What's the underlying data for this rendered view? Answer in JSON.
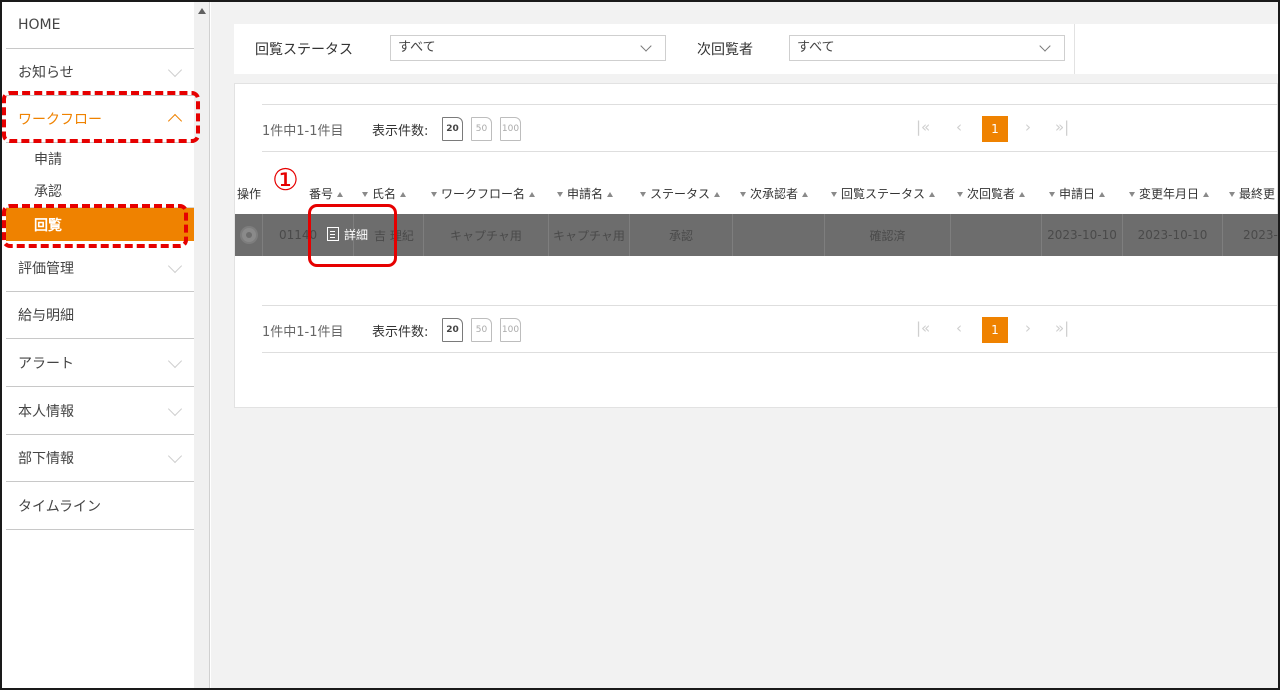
{
  "sidebar": {
    "items": [
      {
        "label": "HOME",
        "has_chevron": false
      },
      {
        "label": "お知らせ",
        "has_chevron": true
      },
      {
        "label": "ワークフロー",
        "active": true
      },
      {
        "label": "評価管理",
        "has_chevron": true
      },
      {
        "label": "給与明細",
        "has_chevron": false
      },
      {
        "label": "アラート",
        "has_chevron": true
      },
      {
        "label": "本人情報",
        "has_chevron": true
      },
      {
        "label": "部下情報",
        "has_chevron": true
      },
      {
        "label": "タイムライン",
        "has_chevron": false
      }
    ],
    "workflow_sub": [
      {
        "label": "申請"
      },
      {
        "label": "承認"
      },
      {
        "label": "回覧",
        "current": true
      }
    ]
  },
  "filters": {
    "status_label": "回覧ステータス",
    "status_value": "すべて",
    "next_viewer_label": "次回覧者",
    "next_viewer_value": "すべて"
  },
  "pager": {
    "count_text": "1件中1-1件目",
    "per_page_label": "表示件数:",
    "sizes": [
      "20",
      "50",
      "100"
    ],
    "selected_size": "20",
    "first_icon": "|«",
    "prev_icon": "‹",
    "current_page": "1",
    "next_icon": "›",
    "last_icon": "»|"
  },
  "table": {
    "headers": [
      "操作",
      "番号",
      "氏名",
      "ワークフロー名",
      "申請名",
      "ステータス",
      "次承認者",
      "回覧ステータス",
      "次回覧者",
      "申請日",
      "変更年月日",
      "最終更"
    ],
    "row": {
      "id": "01140",
      "name_partial": "吉 理紀",
      "workflow": "キャプチャ用",
      "application": "キャプチャ用",
      "status": "承認",
      "next_approver": "",
      "view_status": "確認済",
      "next_viewer": "",
      "applied_date": "2023-10-10",
      "updated_date": "2023-10-10",
      "last": "2023-"
    },
    "detail_button": "詳細"
  },
  "annotation": {
    "marker": "①"
  },
  "colors": {
    "accent": "#ef8200",
    "annotation_red": "#e60000",
    "row_bg": "#6d6d6d"
  }
}
